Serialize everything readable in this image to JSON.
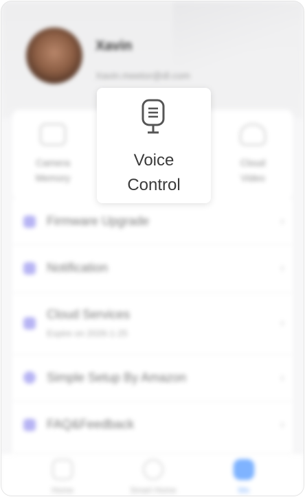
{
  "profile": {
    "name": "Xavin",
    "email": "Xavin.meetor@dl.com"
  },
  "quick_actions": [
    {
      "label": "Camera\nMemory",
      "icon": "sd-card-icon"
    },
    {
      "label": "Cloud\nVideo",
      "icon": "cloud-icon"
    }
  ],
  "menu": {
    "items": [
      {
        "label": "Firmware Upgrade",
        "icon": "firmware-icon"
      },
      {
        "label": "Notification",
        "icon": "bell-icon"
      },
      {
        "label": "Cloud Services",
        "sub": "Expire on 2026-1-25",
        "icon": "cloud-service-icon"
      },
      {
        "label": "Simple Setup By Amazon",
        "icon": "amazon-icon"
      },
      {
        "label": "FAQ&Feedback",
        "icon": "faq-icon"
      }
    ]
  },
  "tabbar": {
    "tabs": [
      {
        "label": "Home",
        "icon": "home-icon"
      },
      {
        "label": "Smart Home",
        "icon": "smart-home-icon"
      },
      {
        "label": "Me",
        "icon": "person-icon"
      }
    ],
    "active_color": "#7fb3ff"
  },
  "popup": {
    "label": "Voice\nControl",
    "icon": "microphone-icon"
  }
}
